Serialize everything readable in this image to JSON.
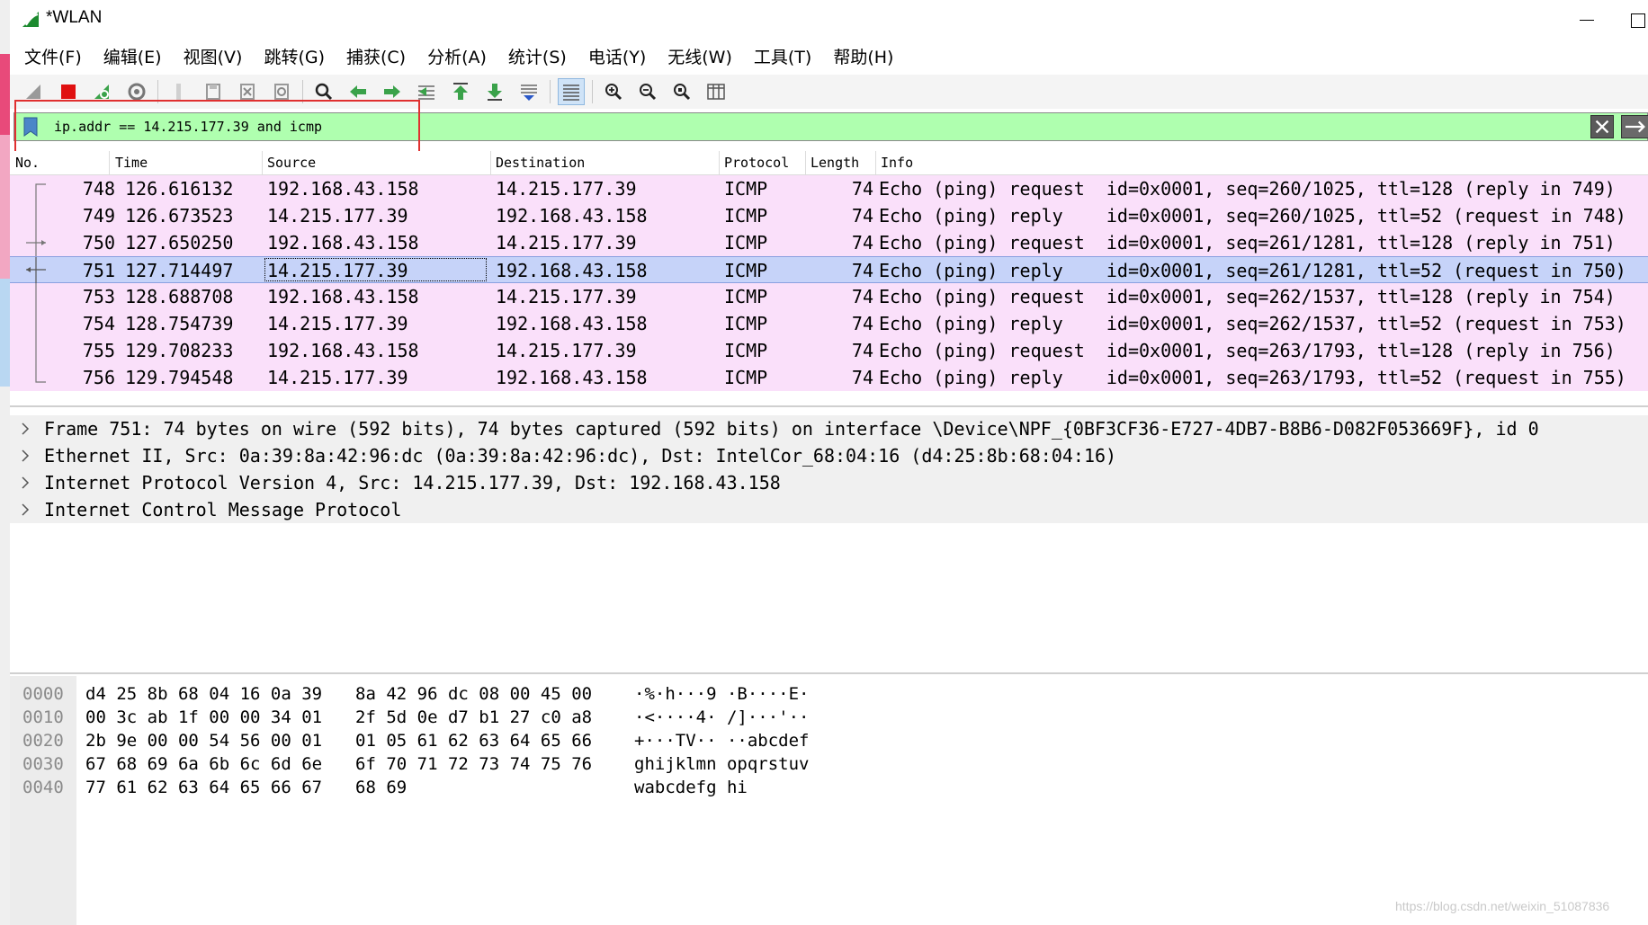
{
  "window": {
    "title": "*WLAN"
  },
  "menu": [
    "文件(F)",
    "编辑(E)",
    "视图(V)",
    "跳转(G)",
    "捕获(C)",
    "分析(A)",
    "统计(S)",
    "电话(Y)",
    "无线(W)",
    "工具(T)",
    "帮助(H)"
  ],
  "toolbar": {
    "icons": [
      "shark-fin-icon",
      "stop-capture-icon",
      "restart-capture-icon",
      "capture-options-icon",
      "open-file-icon",
      "save-file-icon",
      "close-file-icon",
      "reload-file-icon",
      "find-packet-icon",
      "go-back-icon",
      "go-forward-icon",
      "go-to-packet-icon",
      "go-first-icon",
      "go-last-icon",
      "auto-scroll-icon",
      "colorize-icon",
      "zoom-in-icon",
      "zoom-out-icon",
      "normal-size-icon",
      "resize-columns-icon"
    ]
  },
  "filter": {
    "value": "ip.addr == 14.215.177.39 and icmp"
  },
  "packet_list": {
    "columns": [
      "No.",
      "Time",
      "Source",
      "Destination",
      "Protocol",
      "Length",
      "Info"
    ],
    "rows": [
      {
        "no": "748",
        "time": "126.616132",
        "src": "192.168.43.158",
        "dst": "14.215.177.39",
        "proto": "ICMP",
        "len": "74",
        "info": "Echo (ping) request  id=0x0001, seq=260/1025, ttl=128 (reply in 749)"
      },
      {
        "no": "749",
        "time": "126.673523",
        "src": "14.215.177.39",
        "dst": "192.168.43.158",
        "proto": "ICMP",
        "len": "74",
        "info": "Echo (ping) reply    id=0x0001, seq=260/1025, ttl=52 (request in 748)"
      },
      {
        "no": "750",
        "time": "127.650250",
        "src": "192.168.43.158",
        "dst": "14.215.177.39",
        "proto": "ICMP",
        "len": "74",
        "info": "Echo (ping) request  id=0x0001, seq=261/1281, ttl=128 (reply in 751)"
      },
      {
        "no": "751",
        "time": "127.714497",
        "src": "14.215.177.39",
        "dst": "192.168.43.158",
        "proto": "ICMP",
        "len": "74",
        "info": "Echo (ping) reply    id=0x0001, seq=261/1281, ttl=52 (request in 750)"
      },
      {
        "no": "753",
        "time": "128.688708",
        "src": "192.168.43.158",
        "dst": "14.215.177.39",
        "proto": "ICMP",
        "len": "74",
        "info": "Echo (ping) request  id=0x0001, seq=262/1537, ttl=128 (reply in 754)"
      },
      {
        "no": "754",
        "time": "128.754739",
        "src": "14.215.177.39",
        "dst": "192.168.43.158",
        "proto": "ICMP",
        "len": "74",
        "info": "Echo (ping) reply    id=0x0001, seq=262/1537, ttl=52 (request in 753)"
      },
      {
        "no": "755",
        "time": "129.708233",
        "src": "192.168.43.158",
        "dst": "14.215.177.39",
        "proto": "ICMP",
        "len": "74",
        "info": "Echo (ping) request  id=0x0001, seq=263/1793, ttl=128 (reply in 756)"
      },
      {
        "no": "756",
        "time": "129.794548",
        "src": "14.215.177.39",
        "dst": "192.168.43.158",
        "proto": "ICMP",
        "len": "74",
        "info": "Echo (ping) reply    id=0x0001, seq=263/1793, ttl=52 (request in 755)"
      }
    ],
    "selected_index": 3
  },
  "details": [
    "Frame 751: 74 bytes on wire (592 bits), 74 bytes captured (592 bits) on interface \\Device\\NPF_{0BF3CF36-E727-4DB7-B8B6-D082F053669F}, id 0",
    "Ethernet II, Src: 0a:39:8a:42:96:dc (0a:39:8a:42:96:dc), Dst: IntelCor_68:04:16 (d4:25:8b:68:04:16)",
    "Internet Protocol Version 4, Src: 14.215.177.39, Dst: 192.168.43.158",
    "Internet Control Message Protocol"
  ],
  "bytes": [
    {
      "offset": "0000",
      "hex1": "d4 25 8b 68 04 16 0a 39",
      "hex2": "8a 42 96 dc 08 00 45 00",
      "ascii": "·%·h···9 ·B····E·"
    },
    {
      "offset": "0010",
      "hex1": "00 3c ab 1f 00 00 34 01",
      "hex2": "2f 5d 0e d7 b1 27 c0 a8",
      "ascii": "·<····4· /]···'··"
    },
    {
      "offset": "0020",
      "hex1": "2b 9e 00 00 54 56 00 01",
      "hex2": "01 05 61 62 63 64 65 66",
      "ascii": "+···TV·· ··abcdef"
    },
    {
      "offset": "0030",
      "hex1": "67 68 69 6a 6b 6c 6d 6e",
      "hex2": "6f 70 71 72 73 74 75 76",
      "ascii": "ghijklmn opqrstuv"
    },
    {
      "offset": "0040",
      "hex1": "77 61 62 63 64 65 66 67",
      "hex2": "68 69",
      "ascii": "wabcdefg hi"
    }
  ],
  "watermark": "https://blog.csdn.net/weixin_51087836",
  "colors": {
    "row_bg": "#fae0fa",
    "selected_bg": "#c6d3f9",
    "filter_bg": "#afffaf",
    "highlight": "#e03030"
  }
}
